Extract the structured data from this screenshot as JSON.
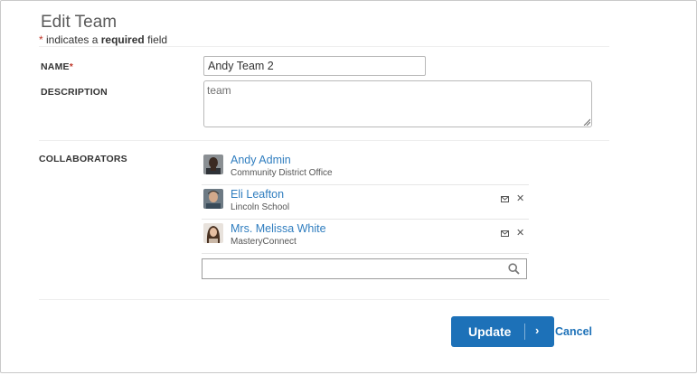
{
  "form": {
    "title": "Edit Team",
    "required_note": {
      "star": "*",
      "prefix": " indicates a ",
      "bold": "required",
      "suffix": " field"
    }
  },
  "fields": {
    "name_label": "NAME",
    "name_star": "*",
    "name_value": "Andy Team 2",
    "description_label": "DESCRIPTION",
    "description_value": "team",
    "collaborators_label": "COLLABORATORS"
  },
  "collaborators": [
    {
      "name": "Andy Admin",
      "org": "Community District Office",
      "removable": false
    },
    {
      "name": "Eli Leafton",
      "org": "Lincoln School",
      "removable": true
    },
    {
      "name": "Mrs. Melissa White",
      "org": "MasteryConnect",
      "removable": true
    }
  ],
  "search": {
    "value": "",
    "placeholder": ""
  },
  "actions": {
    "update_label": "Update",
    "update_chevron": "›",
    "cancel_label": "Cancel"
  },
  "icons": {
    "mail": "envelope-icon",
    "remove": "close-icon",
    "search": "search-icon"
  },
  "colors": {
    "link": "#2f7dbf",
    "primary_button": "#1d71b8",
    "required_star": "#c0392b"
  }
}
